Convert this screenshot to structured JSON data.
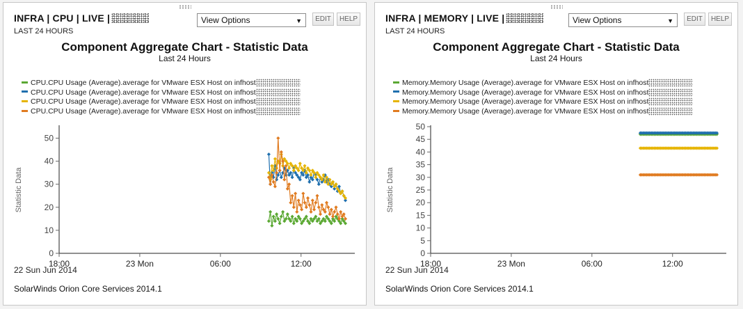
{
  "panels": [
    {
      "title": "INFRA | CPU | LIVE |",
      "subtitle": "LAST 24 HOURS",
      "view_options": "View Options",
      "edit_label": "EDIT",
      "help_label": "HELP",
      "chart_title": "Component Aggregate Chart - Statistic Data",
      "chart_subtitle": "Last 24 Hours",
      "footer": "SolarWinds Orion Core Services 2014.1",
      "legend": [
        "CPU.CPU Usage (Average).average for VMware ESX Host on infhost",
        "CPU.CPU Usage (Average).average for VMware ESX Host on infhost",
        "CPU.CPU Usage (Average).average for VMware ESX Host on infhost",
        "CPU.CPU Usage (Average).average for VMware ESX Host on infhost"
      ],
      "chart_data": {
        "type": "line",
        "ylabel": "Statistic Data",
        "ylim": [
          0,
          55
        ],
        "yticks": [
          "0",
          "10",
          "20",
          "30",
          "40",
          "50"
        ],
        "xticks": [
          "18:00",
          "23 Mon",
          "06:00",
          "12:00"
        ],
        "xdate": "22 Sun Jun 2014",
        "grid": false,
        "legend_position": "top-left",
        "series": [
          {
            "color": "#5aa832",
            "x_start_hour": 9.6,
            "x_end_hour": 15.3,
            "values": [
              14,
              18,
              12,
              16,
              14,
              17,
              15,
              13,
              16,
              18,
              14,
              15,
              17,
              15,
              14,
              16,
              13,
              15,
              14,
              16,
              15,
              13,
              14,
              15,
              16,
              14,
              13,
              15,
              14,
              15,
              16,
              14,
              15,
              13,
              14,
              15,
              14,
              16,
              15,
              14,
              13,
              15,
              14,
              16,
              15,
              14,
              13,
              15,
              14,
              13
            ]
          },
          {
            "color": "#1f6fae",
            "x_start_hour": 9.6,
            "x_end_hour": 15.3,
            "values": [
              43,
              30,
              35,
              33,
              38,
              32,
              34,
              36,
              33,
              35,
              37,
              34,
              36,
              34,
              35,
              33,
              37,
              35,
              34,
              33,
              32,
              35,
              34,
              36,
              33,
              34,
              31,
              33,
              32,
              35,
              34,
              32,
              30,
              33,
              31,
              32,
              34,
              31,
              32,
              30,
              29,
              31,
              28,
              30,
              27,
              29,
              26,
              27,
              25,
              23
            ]
          },
          {
            "color": "#e6b400",
            "x_start_hour": 9.6,
            "x_end_hour": 15.3,
            "values": [
              35,
              32,
              38,
              36,
              41,
              37,
              40,
              39,
              43,
              38,
              41,
              40,
              39,
              37,
              39,
              38,
              36,
              38,
              37,
              36,
              39,
              37,
              36,
              38,
              35,
              37,
              36,
              34,
              36,
              35,
              33,
              35,
              34,
              33,
              32,
              34,
              31,
              33,
              30,
              32,
              30,
              31,
              29,
              30,
              28,
              27,
              26,
              27,
              25,
              24
            ]
          },
          {
            "color": "#e07b20",
            "x_start_hour": 9.6,
            "x_end_hour": 15.3,
            "values": [
              33,
              30,
              34,
              31,
              29,
              35,
              50,
              36,
              44,
              40,
              32,
              38,
              28,
              30,
              22,
              25,
              20,
              26,
              18,
              23,
              21,
              19,
              26,
              22,
              20,
              24,
              21,
              18,
              23,
              19,
              22,
              25,
              20,
              17,
              21,
              19,
              18,
              22,
              20,
              17,
              19,
              16,
              18,
              20,
              17,
              15,
              18,
              16,
              17,
              15
            ]
          }
        ]
      }
    },
    {
      "title": "INFRA | MEMORY | LIVE |",
      "subtitle": "LAST 24 HOURS",
      "view_options": "View Options",
      "edit_label": "EDIT",
      "help_label": "HELP",
      "chart_title": "Component Aggregate Chart - Statistic Data",
      "chart_subtitle": "Last 24 Hours",
      "footer": "SolarWinds Orion Core Services 2014.1",
      "legend": [
        "Memory.Memory Usage (Average).average for VMware ESX Host on infhost",
        "Memory.Memory Usage (Average).average for VMware ESX Host on infhost",
        "Memory.Memory Usage (Average).average for VMware ESX Host on infhost",
        "Memory.Memory Usage (Average).average for VMware ESX Host on infhost"
      ],
      "chart_data": {
        "type": "line",
        "ylabel": "Statistic Data",
        "ylim": [
          0,
          50
        ],
        "yticks": [
          "0",
          "5",
          "10",
          "15",
          "20",
          "25",
          "30",
          "35",
          "40",
          "45",
          "50"
        ],
        "xticks": [
          "18:00",
          "23 Mon",
          "06:00",
          "12:00"
        ],
        "xdate": "22 Sun Jun 2014",
        "grid": false,
        "legend_position": "top-left",
        "series": [
          {
            "color": "#5aa832",
            "x_start_hour": 9.6,
            "x_end_hour": 15.3,
            "constant": 47,
            "count": 50
          },
          {
            "color": "#1f6fae",
            "x_start_hour": 9.6,
            "x_end_hour": 15.3,
            "constant": 47.5,
            "count": 50
          },
          {
            "color": "#e6b400",
            "x_start_hour": 9.6,
            "x_end_hour": 15.3,
            "constant": 41.5,
            "count": 50
          },
          {
            "color": "#e07b20",
            "x_start_hour": 9.6,
            "x_end_hour": 15.3,
            "constant": 31,
            "count": 50
          }
        ]
      }
    }
  ]
}
